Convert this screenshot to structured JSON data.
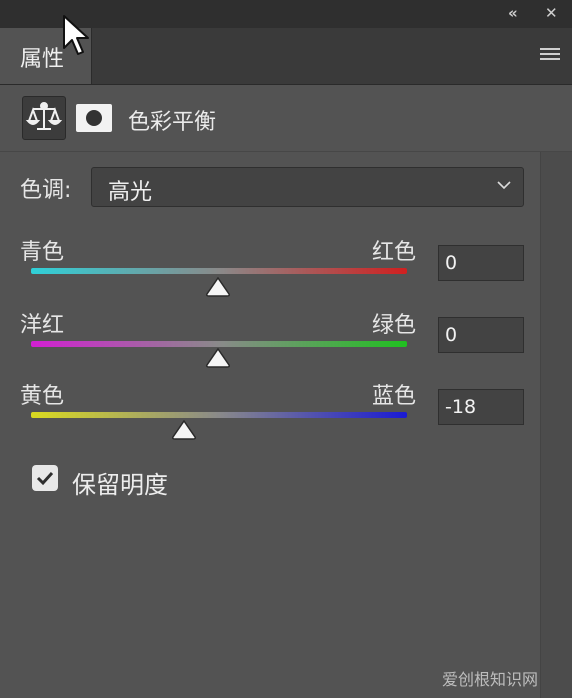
{
  "window": {
    "collapse_glyph": "«",
    "close_glyph": "✕"
  },
  "panel": {
    "tab_label": "属性",
    "menu_icon": "hamburger-menu-icon"
  },
  "header": {
    "balance_icon": "scale-balance-icon",
    "mask_icon": "layer-mask-icon",
    "title": "色彩平衡"
  },
  "tone": {
    "label": "色调:",
    "selected": "高光"
  },
  "sliders": [
    {
      "left_label": "青色",
      "right_label": "红色",
      "value": "0",
      "colors": [
        "#2fd0d8",
        "#8a8a8a",
        "#d02020"
      ]
    },
    {
      "left_label": "洋红",
      "right_label": "绿色",
      "value": "0",
      "colors": [
        "#d21fd2",
        "#8a8a8a",
        "#20c020"
      ]
    },
    {
      "left_label": "黄色",
      "right_label": "蓝色",
      "value": "-18",
      "colors": [
        "#dada20",
        "#8a8a8a",
        "#1a1ad4"
      ]
    }
  ],
  "preserve": {
    "label": "保留明度",
    "checked": true
  },
  "watermark": "爱创根知识网"
}
